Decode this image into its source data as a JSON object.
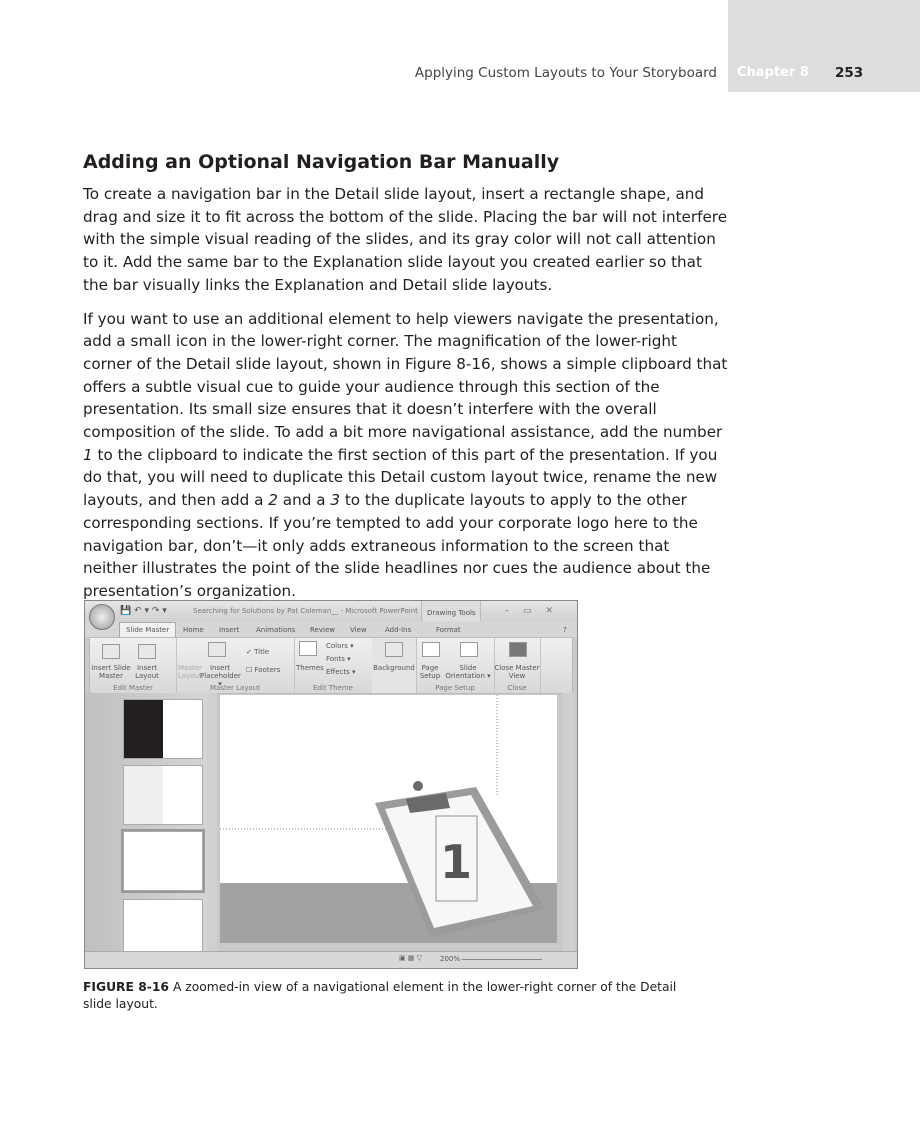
{
  "header": {
    "running_title": "Applying Custom Layouts to Your Storyboard",
    "chapter": "Chapter 8",
    "page_number": "253"
  },
  "section": {
    "heading": "Adding an Optional Navigation Bar Manually",
    "para1": "To create a navigation bar in the Detail slide layout, insert a rectangle shape, and drag and size it to fit across the bottom of the slide. Placing the bar will not interfere with the simple visual reading of the slides, and its gray color will not call attention to it. Add the same bar to the Explanation slide layout you created earlier so that the bar visually links the Explanation and Detail slide layouts.",
    "para2": {
      "s1": "If you want to use an additional element to help viewers navigate the presentation, add a small icon in the lower-right corner. The magnification of the lower-right corner of the Detail slide layout, shown in Figure 8-16, shows a simple clipboard that offers a subtle visual cue to guide your audience through this section of the presentation. Its small size ensures that it doesn’t interfere with the overall composition of the slide. To add a bit more navigational assistance, add the number ",
      "i1": "1",
      "s2": " to the clipboard to indicate the first section of this part of the presentation. If you do that, you will need to duplicate this Detail custom layout twice, rename the new layouts, and then add a ",
      "i2": "2",
      "s3": " and a ",
      "i3": "3",
      "s4": " to the duplicate layouts to apply to the other corresponding sections. If you’re tempted to add your corporate logo here to the navigation bar, don’t—it only adds extraneous information to the screen that neither illustrates the point of the slide headlines nor cues the audience about the presentation’s organization."
    }
  },
  "screenshot": {
    "window_title": "Searching for Solutions by Pat Coleman__ - Microsoft PowerPoint",
    "contextual_group": "Drawing Tools",
    "tabs": [
      "Slide Master",
      "Home",
      "Insert",
      "Animations",
      "Review",
      "View",
      "Add-Ins",
      "Format"
    ],
    "groups": {
      "edit_master": {
        "label": "Edit Master",
        "insert_slide_master": "Insert Slide Master",
        "insert_layout": "Insert Layout"
      },
      "master_layout": {
        "label": "Master Layout",
        "master_layout": "Master Layout",
        "insert_placeholder": "Insert Placeholder ▾",
        "title": "Title",
        "footers": "Footers"
      },
      "edit_theme": {
        "label": "Edit Theme",
        "themes": "Themes",
        "colors": "Colors ▾",
        "fonts": "Fonts ▾",
        "effects": "Effects ▾"
      },
      "background": {
        "label": "Background"
      },
      "page_setup": {
        "label": "Page Setup",
        "page_setup": "Page Setup",
        "slide_orientation": "Slide Orientation ▾"
      },
      "close": {
        "label": "Close",
        "close_master_view": "Close Master View"
      }
    },
    "clipboard_number": "1",
    "zoom_level": "200%"
  },
  "figure": {
    "label": "FIGURE 8-16",
    "caption": "A zoomed-in view of a navigational element in the lower-right corner of the Detail slide layout."
  }
}
